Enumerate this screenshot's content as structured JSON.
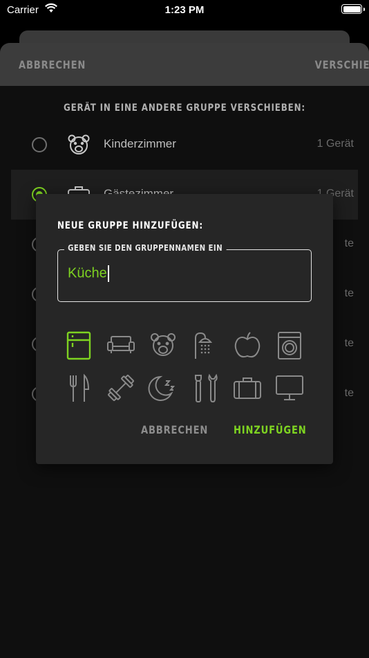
{
  "status_bar": {
    "carrier": "Carrier",
    "time": "1:23 PM"
  },
  "header": {
    "cancel_label": "ABBRECHEN",
    "move_label": "VERSCHIEBEN"
  },
  "section_title": "GERÄT IN EINE ANDERE GRUPPE VERSCHIEBEN:",
  "groups": [
    {
      "name": "Kinderzimmer",
      "count": "1 Gerät",
      "selected": false,
      "icon": "teddy-bear-icon"
    },
    {
      "name": "Gästezimmer",
      "count": "1 Gerät",
      "selected": true,
      "icon": "suitcase-icon"
    },
    {
      "name": "",
      "count": "te",
      "selected": false,
      "icon": ""
    },
    {
      "name": "",
      "count": "te",
      "selected": false,
      "icon": ""
    },
    {
      "name": "",
      "count": "te",
      "selected": false,
      "icon": ""
    },
    {
      "name": "",
      "count": "te",
      "selected": false,
      "icon": ""
    }
  ],
  "dialog": {
    "title": "NEUE GRUPPE HINZUFÜGEN:",
    "field_label": "GEBEN SIE DEN GRUPPENNAMEN EIN",
    "field_value": "Küche",
    "icons": [
      "fridge-icon",
      "sofa-icon",
      "teddy-bear-icon",
      "shower-icon",
      "apple-icon",
      "washing-machine-icon",
      "cutlery-icon",
      "dumbbell-icon",
      "sleep-moon-icon",
      "tools-icon",
      "suitcase-icon",
      "monitor-icon"
    ],
    "selected_icon": "fridge-icon",
    "cancel_label": "ABBRECHEN",
    "add_label": "HINZUFÜGEN"
  },
  "colors": {
    "accent": "#7ed321",
    "background": "#0f0f0f",
    "dialog": "#262626",
    "header": "#3c3c3c"
  }
}
